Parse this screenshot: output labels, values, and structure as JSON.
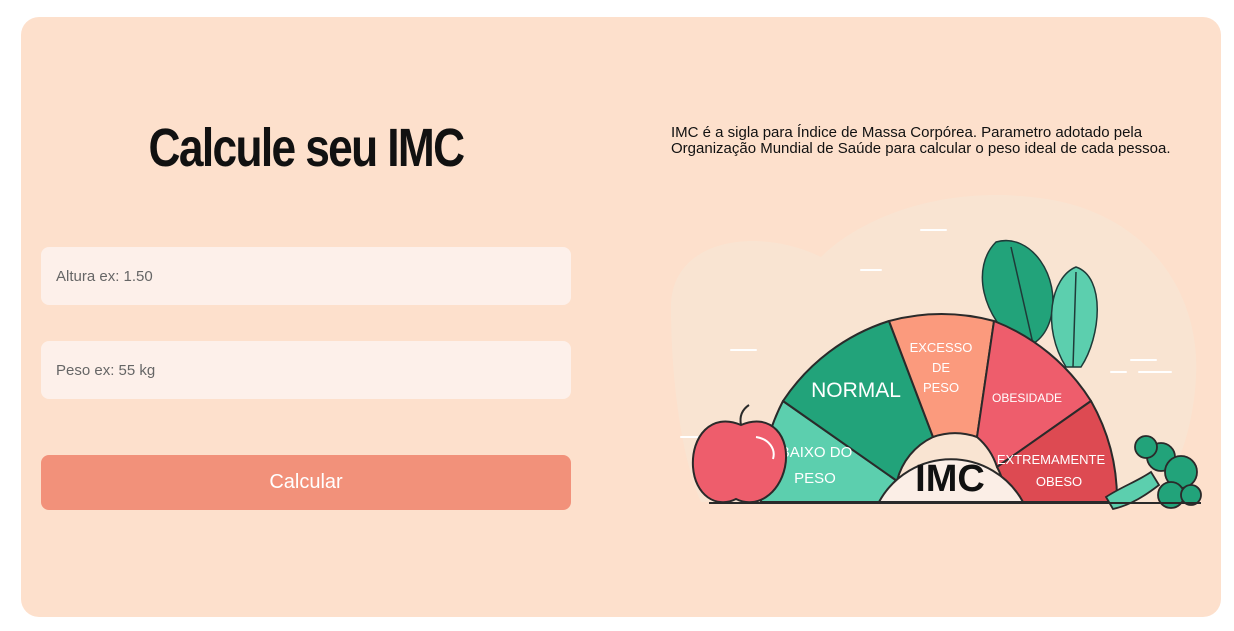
{
  "title": "Calcule seu IMC",
  "form": {
    "altura_placeholder": "Altura ex: 1.50",
    "peso_placeholder": "Peso ex: 55 kg",
    "button_label": "Calcular"
  },
  "description": "IMC é a sigla para Índice de Massa Corpórea. Parametro adotado pela Organização Mundial de Saúde para calcular o peso ideal de cada pessoa.",
  "gauge": {
    "center_label": "IMC",
    "segments": {
      "abaixo_line1": "ABAIXO DO",
      "abaixo_line2": "PESO",
      "normal": "NORMAL",
      "excesso_line1": "EXCESSO",
      "excesso_line2": "DE",
      "excesso_line3": "PESO",
      "obesidade": "OBESIDADE",
      "extremamente_line1": "EXTREMAMENTE",
      "extremamente_line2": "OBESO"
    }
  },
  "colors": {
    "card_bg": "#fde0cc",
    "input_bg": "#fdf0ea",
    "button_bg": "#f2917a",
    "teal_light": "#5ccfae",
    "teal_dark": "#22a37a",
    "salmon": "#fb9a7d",
    "pink": "#ee5d6c",
    "red": "#dd4a52"
  }
}
